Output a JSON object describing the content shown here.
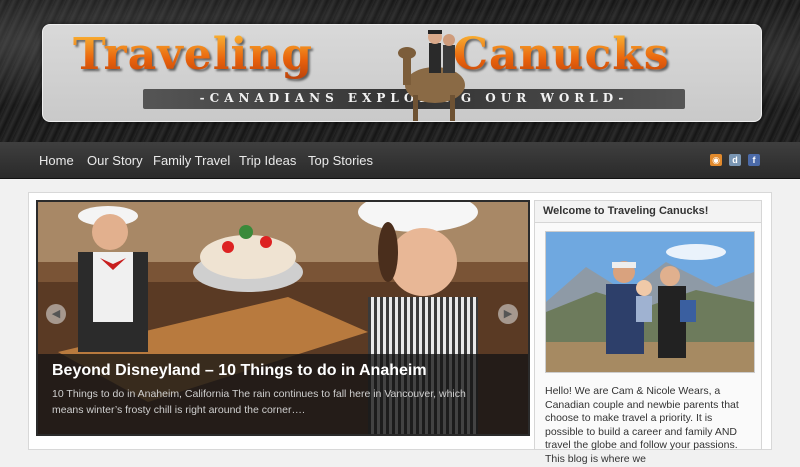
{
  "header": {
    "logo_left": "Traveling",
    "logo_right": "Canucks",
    "tagline": "-CANADIANS EXPLORING OUR WORLD-"
  },
  "nav": {
    "items": [
      "Home",
      "Our Story",
      "Family Travel",
      "Trip Ideas",
      "Top Stories"
    ]
  },
  "social_icons": [
    "rss-icon",
    "delicious-icon",
    "facebook-icon"
  ],
  "slider": {
    "title": "Beyond Disneyland – 10 Things to do in Anaheim",
    "excerpt": "10 Things to do in Anaheim, California The rain continues to fall here in Vancouver, which means winter’s frosty chill is right around the corner….",
    "prev_icon": "chevron-left-icon",
    "next_icon": "chevron-right-icon"
  },
  "sidebar": {
    "widget_title": "Welcome to Traveling Canucks!",
    "intro": "Hello! We are Cam & Nicole Wears, a Canadian couple and newbie parents that choose to make travel a priority. It is possible to build a career and family AND travel the globe and follow your passions. This blog is where we"
  },
  "colors": {
    "logo_orange": "#ef7d12",
    "nav_bg": "#333333",
    "caption_bg": "#141414"
  }
}
